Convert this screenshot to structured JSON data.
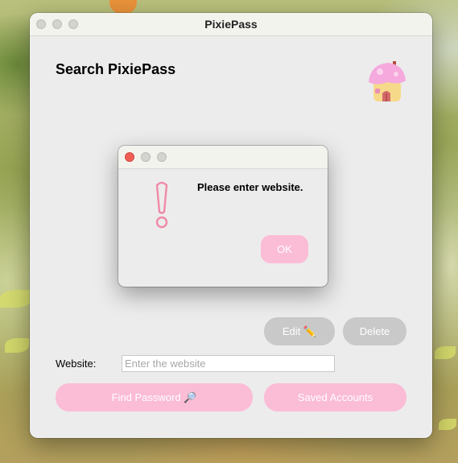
{
  "window": {
    "title": "PixiePass"
  },
  "app": {
    "heading": "Search PixiePass",
    "logo_icon": "mushroom-house-icon"
  },
  "actions": {
    "edit_label": "Edit ✏️",
    "delete_label": "Delete",
    "find_label": "Find Password 🔎",
    "saved_label": "Saved Accounts"
  },
  "form": {
    "website_label": "Website:",
    "website_placeholder": "Enter the website",
    "website_value": ""
  },
  "dialog": {
    "message": "Please enter website.",
    "ok_label": "OK",
    "icon": "exclamation-icon"
  },
  "colors": {
    "accent_pink": "#fbbcd6",
    "exclamation_pink": "#f08aa8",
    "disabled_grey": "#c9c9c9",
    "close_red": "#ee5e55"
  }
}
